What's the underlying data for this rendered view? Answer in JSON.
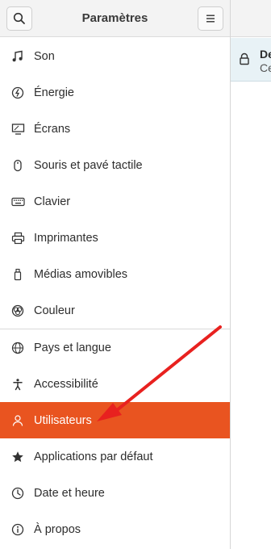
{
  "header": {
    "title": "Paramètres"
  },
  "sidebar": {
    "items": [
      {
        "label": "Son",
        "icon": "music-note-icon"
      },
      {
        "label": "Énergie",
        "icon": "power-icon"
      },
      {
        "label": "Écrans",
        "icon": "display-icon"
      },
      {
        "label": "Souris et pavé tactile",
        "icon": "mouse-icon"
      },
      {
        "label": "Clavier",
        "icon": "keyboard-icon"
      },
      {
        "label": "Imprimantes",
        "icon": "printer-icon"
      },
      {
        "label": "Médias amovibles",
        "icon": "removable-media-icon"
      },
      {
        "label": "Couleur",
        "icon": "color-icon"
      },
      {
        "label": "Pays et langue",
        "icon": "globe-icon"
      },
      {
        "label": "Accessibilité",
        "icon": "accessibility-icon"
      },
      {
        "label": "Utilisateurs",
        "icon": "user-icon",
        "active": true
      },
      {
        "label": "Applications par défaut",
        "icon": "star-icon"
      },
      {
        "label": "Date et heure",
        "icon": "clock-icon"
      },
      {
        "label": "À propos",
        "icon": "info-icon"
      }
    ]
  },
  "right_panel": {
    "unlock_title": "De",
    "unlock_subtitle": "Ce"
  },
  "colors": {
    "accent": "#e95420",
    "annotation_arrow": "#e8211f",
    "banner": "#e8f2f6"
  }
}
